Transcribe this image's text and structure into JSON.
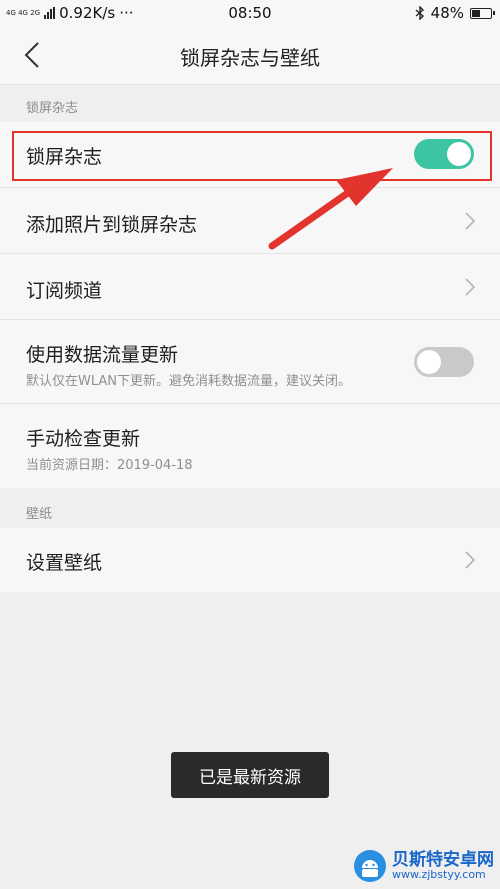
{
  "status_bar": {
    "network": "4G 4G 2G",
    "speed": "0.92K/s",
    "dots": "···",
    "time": "08:50",
    "battery": "48%",
    "battery_level": 48
  },
  "header": {
    "title": "锁屏杂志与壁纸"
  },
  "sections": {
    "magazine_label": "锁屏杂志",
    "wallpaper_label": "壁纸"
  },
  "rows": {
    "lock_magazine": {
      "title": "锁屏杂志",
      "toggle": "on"
    },
    "add_photos": {
      "title": "添加照片到锁屏杂志"
    },
    "subscribe": {
      "title": "订阅频道"
    },
    "mobile_data": {
      "title": "使用数据流量更新",
      "subtitle": "默认仅在WLAN下更新。避免消耗数据流量，建议关闭。",
      "toggle": "off"
    },
    "manual_check": {
      "title": "手动检查更新",
      "subtitle": "当前资源日期：2019-04-18"
    },
    "set_wallpaper": {
      "title": "设置壁纸"
    }
  },
  "toast": {
    "text": "已是最新资源"
  },
  "watermark": {
    "name": "贝斯特安卓网",
    "url": "www.zjbstyy.com"
  },
  "colors": {
    "accent": "#3dc4a2",
    "annotation": "#e2332d",
    "toggle_off": "#c9c9c9"
  }
}
